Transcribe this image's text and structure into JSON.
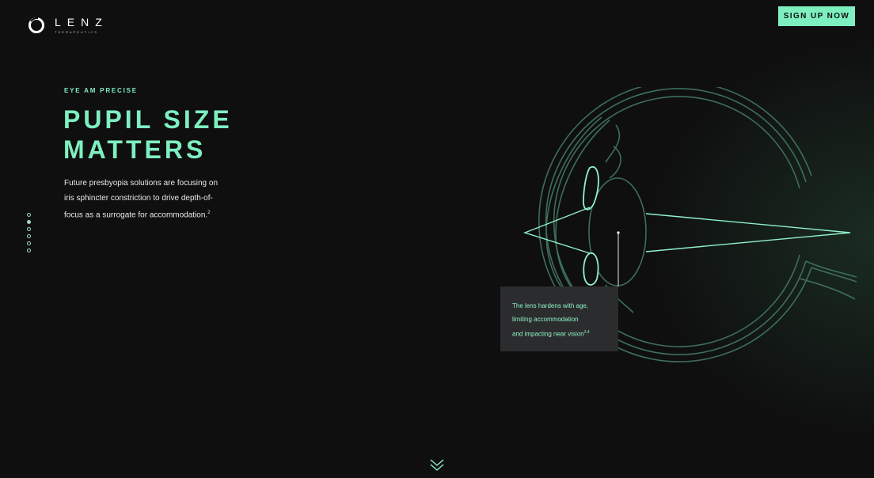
{
  "header": {
    "logo_word": "LENZ",
    "logo_sub": "THERAPEUTICS",
    "signup_label": "SIGN UP NOW"
  },
  "hero": {
    "eyebrow": "EYE AM PRECISE",
    "headline_line1": "PUPIL SIZE",
    "headline_line2": "MATTERS",
    "body_line1": "Future presbyopia solutions are focusing on",
    "body_line2": "iris sphincter constriction to drive depth-of-",
    "body_line3": "focus as a surrogate for accommodation.",
    "body_ref": "2"
  },
  "dot_nav": {
    "count": 6,
    "active_index": 1
  },
  "callout": {
    "line1": "The lens hardens with age,",
    "line2": "limiting accommodation",
    "line3": "and impacting near vision",
    "ref": "3,4"
  },
  "icons": {
    "logo": "lenz-logo-ring-icon",
    "eye": "eye-cross-section-illustration",
    "scroll": "double-chevron-down-icon"
  },
  "colors": {
    "accent": "#7ef0c0",
    "background": "#0f0f10",
    "callout_bg": "#2b2c2d",
    "eye_lines": "#3d6f59"
  }
}
